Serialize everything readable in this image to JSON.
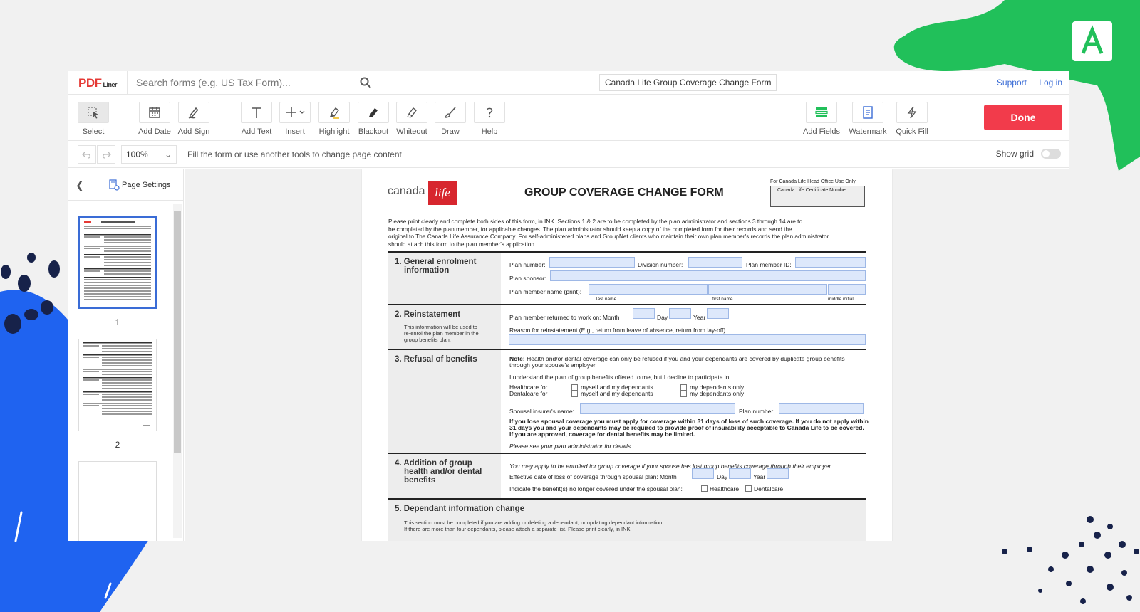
{
  "app": {
    "logo_main": "PDF",
    "logo_sub": "Liner",
    "search_placeholder": "Search forms (e.g. US Tax Form)...",
    "doc_title": "Canada Life Group Coverage Change Form",
    "support_label": "Support",
    "login_label": "Log in"
  },
  "toolbar": {
    "select": "Select",
    "add_date": "Add Date",
    "add_sign": "Add Sign",
    "add_text": "Add Text",
    "insert": "Insert",
    "highlight": "Highlight",
    "blackout": "Blackout",
    "whiteout": "Whiteout",
    "draw": "Draw",
    "help": "Help",
    "add_fields": "Add Fields",
    "watermark": "Watermark",
    "quick_fill": "Quick Fill",
    "done": "Done"
  },
  "subbar": {
    "zoom": "100%",
    "hint": "Fill the form or use another tools to change page content",
    "show_grid": "Show grid"
  },
  "sidebar": {
    "page_settings": "Page Settings",
    "pages": [
      "1",
      "2"
    ]
  },
  "form": {
    "brand": "canada",
    "brand_script": "life",
    "title": "GROUP COVERAGE CHANGE FORM",
    "office_use": "For Canada Life Head Office Use Only",
    "cert_number": "Canada Life Certificate Number",
    "intro_1": "Please print clearly and complete both sides of this form, in INK. Sections 1 & 2 are to be completed by the plan administrator and sections 3 through 14 are to",
    "intro_2": "be completed by the plan member, for applicable changes. The plan administrator should keep a copy of the completed form for their records and send the",
    "intro_3": "original to The Canada Life Assurance Company. For self-administered plans and GroupNet clients who maintain their own plan member's records the plan administrator",
    "intro_4": "should attach this form to the plan member's application.",
    "s1": {
      "title_1": "1. General enrolment",
      "title_2": "information",
      "plan_number": "Plan number:",
      "division_number": "Division number:",
      "member_id": "Plan member ID:",
      "plan_sponsor": "Plan sponsor:",
      "member_name": "Plan member name (print):",
      "last_name": "last name",
      "first_name": "first name",
      "middle_initial": "middle initial"
    },
    "s2": {
      "title": "2. Reinstatement",
      "note_1": "This information will be used to",
      "note_2": "re-enrol the plan member in the",
      "note_3": "group benefits plan.",
      "returned": "Plan member returned to work on:  Month",
      "day": "Day",
      "year": "Year",
      "reason": "Reason for reinstatement (E.g., return from leave of absence, return from lay-off)"
    },
    "s3": {
      "title": "3. Refusal of benefits",
      "note_label": "Note:",
      "note_1": "Health and/or dental coverage can only be refused if you and your dependants are covered by duplicate group benefits",
      "note_2": "through your spouse's employer.",
      "understand": "I understand the plan of group benefits offered to me, but I decline to participate in:",
      "healthcare_for": "Healthcare for",
      "dentalcare_for": "Dentalcare for",
      "myself_deps": "myself and my dependants",
      "deps_only": "my dependants only",
      "spousal_insurer": "Spousal insurer's name:",
      "plan_number": "Plan number:",
      "warn_1": "If you lose spousal coverage you must apply for coverage within 31 days of loss of such coverage. If you do not apply within",
      "warn_2": "31 days you and your dependants may be required to provide proof of insurability acceptable to Canada Life to be covered.",
      "warn_3": "If you are approved, coverage for dental benefits may be limited.",
      "see_admin": "Please see your plan administrator for details."
    },
    "s4": {
      "title_1": "4. Addition of group",
      "title_2": "health and/or dental",
      "title_3": "benefits",
      "may_apply": "You may apply to be enrolled for group coverage if your spouse has lost group benefits coverage through their employer.",
      "effective": "Effective date of loss of coverage through spousal plan:  Month",
      "day": "Day",
      "year": "Year",
      "indicate": "Indicate the benefit(s) no longer covered under the spousal plan:",
      "healthcare": "Healthcare",
      "dentalcare": "Dentalcare"
    },
    "s5": {
      "title": "5. Dependant information change",
      "note_1": "This section must be completed if you are adding or deleting a dependant, or updating dependant information.",
      "note_2": "If there are more than four dependants, please attach a separate list. Please print clearly, in INK."
    }
  }
}
